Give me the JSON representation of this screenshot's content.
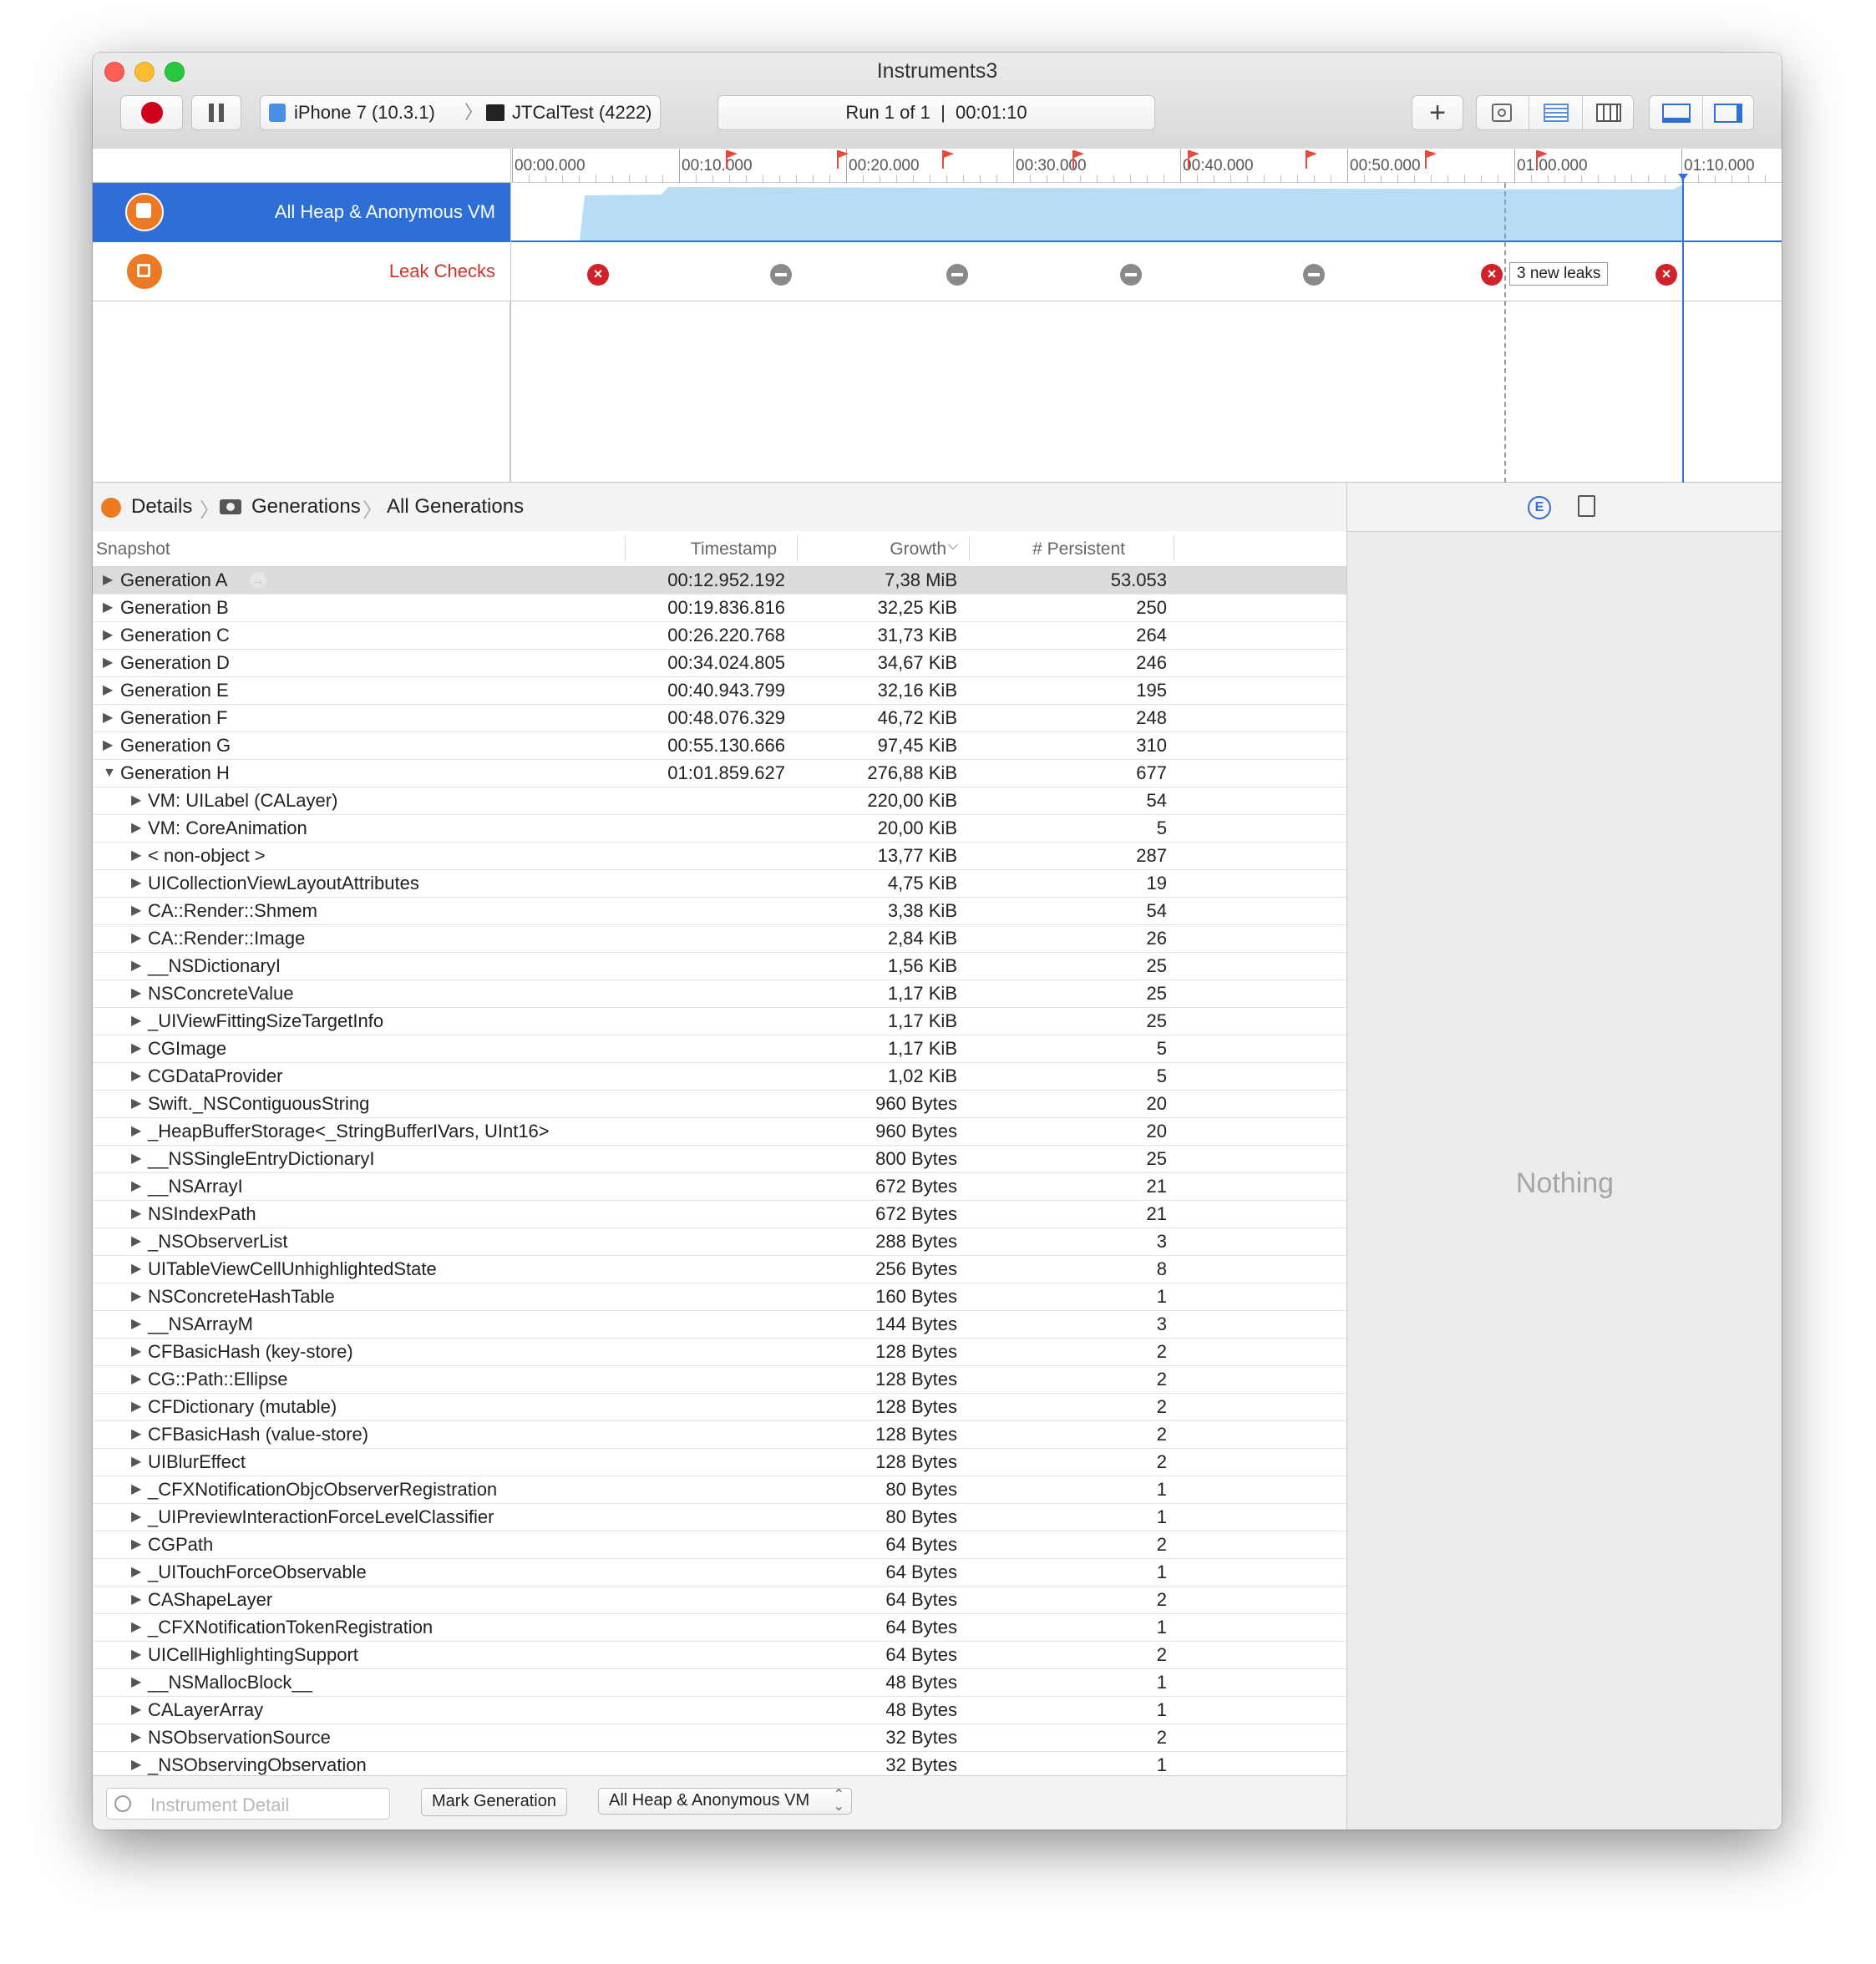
{
  "window": {
    "title": "Instruments3"
  },
  "toolbar": {
    "device": "iPhone 7 (10.3.1)",
    "target": "JTCalTest (4222)",
    "run_status": "Run 1 of 1  |  00:01:10"
  },
  "timeline": {
    "ticks": [
      "00:00.000",
      "00:10.000",
      "00:20.000",
      "00:30.000",
      "00:40.000",
      "00:50.000",
      "01:00.000",
      "01:10.000"
    ],
    "leak_annotation": "3 new leaks"
  },
  "tracks": [
    {
      "name": "All Heap & Anonymous VM"
    },
    {
      "name": "Leak Checks"
    }
  ],
  "jumpbar": {
    "items": [
      "Details",
      "Generations",
      "All Generations"
    ]
  },
  "table": {
    "headers": {
      "snapshot": "Snapshot",
      "timestamp": "Timestamp",
      "growth": "Growth",
      "persistent": "# Persistent"
    },
    "generations": [
      {
        "name": "Generation A",
        "timestamp": "00:12.952.192",
        "growth": "7,38 MiB",
        "persistent": "53.053"
      },
      {
        "name": "Generation B",
        "timestamp": "00:19.836.816",
        "growth": "32,25 KiB",
        "persistent": "250"
      },
      {
        "name": "Generation C",
        "timestamp": "00:26.220.768",
        "growth": "31,73 KiB",
        "persistent": "264"
      },
      {
        "name": "Generation D",
        "timestamp": "00:34.024.805",
        "growth": "34,67 KiB",
        "persistent": "246"
      },
      {
        "name": "Generation E",
        "timestamp": "00:40.943.799",
        "growth": "32,16 KiB",
        "persistent": "195"
      },
      {
        "name": "Generation F",
        "timestamp": "00:48.076.329",
        "growth": "46,72 KiB",
        "persistent": "248"
      },
      {
        "name": "Generation G",
        "timestamp": "00:55.130.666",
        "growth": "97,45 KiB",
        "persistent": "310"
      },
      {
        "name": "Generation H",
        "timestamp": "01:01.859.627",
        "growth": "276,88 KiB",
        "persistent": "677"
      }
    ],
    "children": [
      {
        "name": "VM: UILabel (CALayer)",
        "growth": "220,00 KiB",
        "persistent": "54"
      },
      {
        "name": "VM: CoreAnimation",
        "growth": "20,00 KiB",
        "persistent": "5"
      },
      {
        "name": "< non-object >",
        "growth": "13,77 KiB",
        "persistent": "287"
      },
      {
        "name": "UICollectionViewLayoutAttributes",
        "growth": "4,75 KiB",
        "persistent": "19"
      },
      {
        "name": "CA::Render::Shmem",
        "growth": "3,38 KiB",
        "persistent": "54"
      },
      {
        "name": "CA::Render::Image",
        "growth": "2,84 KiB",
        "persistent": "26"
      },
      {
        "name": "__NSDictionaryI",
        "growth": "1,56 KiB",
        "persistent": "25"
      },
      {
        "name": "NSConcreteValue",
        "growth": "1,17 KiB",
        "persistent": "25"
      },
      {
        "name": "_UIViewFittingSizeTargetInfo",
        "growth": "1,17 KiB",
        "persistent": "25"
      },
      {
        "name": "CGImage",
        "growth": "1,17 KiB",
        "persistent": "5"
      },
      {
        "name": "CGDataProvider",
        "growth": "1,02 KiB",
        "persistent": "5"
      },
      {
        "name": "Swift._NSContiguousString",
        "growth": "960 Bytes",
        "persistent": "20"
      },
      {
        "name": "_HeapBufferStorage<_StringBufferIVars, UInt16>",
        "growth": "960 Bytes",
        "persistent": "20"
      },
      {
        "name": "__NSSingleEntryDictionaryI",
        "growth": "800 Bytes",
        "persistent": "25"
      },
      {
        "name": "__NSArrayI",
        "growth": "672 Bytes",
        "persistent": "21"
      },
      {
        "name": "NSIndexPath",
        "growth": "672 Bytes",
        "persistent": "21"
      },
      {
        "name": "_NSObserverList",
        "growth": "288 Bytes",
        "persistent": "3"
      },
      {
        "name": "UITableViewCellUnhighlightedState",
        "growth": "256 Bytes",
        "persistent": "8"
      },
      {
        "name": "NSConcreteHashTable",
        "growth": "160 Bytes",
        "persistent": "1"
      },
      {
        "name": "__NSArrayM",
        "growth": "144 Bytes",
        "persistent": "3"
      },
      {
        "name": "CFBasicHash (key-store)",
        "growth": "128 Bytes",
        "persistent": "2"
      },
      {
        "name": "CG::Path::Ellipse",
        "growth": "128 Bytes",
        "persistent": "2"
      },
      {
        "name": "CFDictionary (mutable)",
        "growth": "128 Bytes",
        "persistent": "2"
      },
      {
        "name": "CFBasicHash (value-store)",
        "growth": "128 Bytes",
        "persistent": "2"
      },
      {
        "name": "UIBlurEffect",
        "growth": "128 Bytes",
        "persistent": "2"
      },
      {
        "name": "_CFXNotificationObjcObserverRegistration",
        "growth": "80 Bytes",
        "persistent": "1"
      },
      {
        "name": "_UIPreviewInteractionForceLevelClassifier",
        "growth": "80 Bytes",
        "persistent": "1"
      },
      {
        "name": "CGPath",
        "growth": "64 Bytes",
        "persistent": "2"
      },
      {
        "name": "_UITouchForceObservable",
        "growth": "64 Bytes",
        "persistent": "1"
      },
      {
        "name": "CAShapeLayer",
        "growth": "64 Bytes",
        "persistent": "2"
      },
      {
        "name": "_CFXNotificationTokenRegistration",
        "growth": "64 Bytes",
        "persistent": "1"
      },
      {
        "name": "UICellHighlightingSupport",
        "growth": "64 Bytes",
        "persistent": "2"
      },
      {
        "name": "__NSMallocBlock__",
        "growth": "48 Bytes",
        "persistent": "1"
      },
      {
        "name": "CALayerArray",
        "growth": "48 Bytes",
        "persistent": "1"
      },
      {
        "name": "NSObservationSource",
        "growth": "32 Bytes",
        "persistent": "2"
      },
      {
        "name": "_NSObservingObservation",
        "growth": "32 Bytes",
        "persistent": "1"
      }
    ]
  },
  "inspector": {
    "empty_text": "Nothing"
  },
  "bottom": {
    "filter_placeholder": "Instrument Detail",
    "mark_button": "Mark Generation",
    "instrument_select": "All Heap & Anonymous VM"
  },
  "colors": {
    "accent": "#2f6fd6",
    "record": "#d0021b",
    "instrument": "#ec7a24",
    "graph_fill": "#b7dcf5"
  },
  "icons": [
    "record-icon",
    "pause-icon",
    "device-icon",
    "terminal-icon",
    "add-icon",
    "settings-icon",
    "list-view-icon",
    "table-view-icon",
    "bottom-panel-icon",
    "right-panel-icon",
    "flag-icon",
    "leak-error-icon",
    "leak-ok-icon",
    "heap-icon",
    "leaks-icon",
    "camera-icon",
    "filter-icon",
    "info-icon",
    "document-icon"
  ]
}
